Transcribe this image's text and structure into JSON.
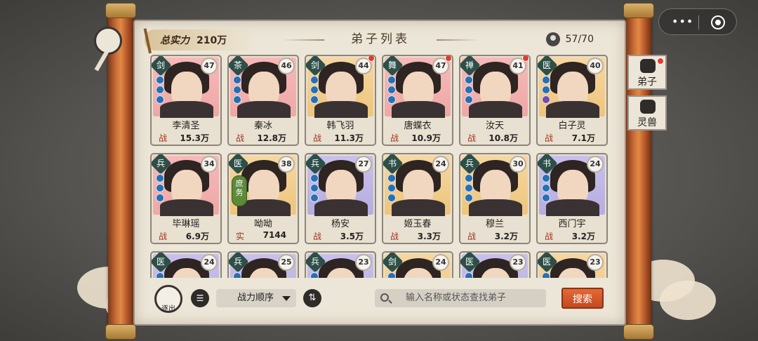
{
  "header": {
    "power_label": "总实力",
    "power_value": "210万",
    "title": "弟子列表",
    "count": "57/70"
  },
  "cards": [
    {
      "tag": "剑",
      "level": "47",
      "name": "李清圣",
      "stat_label": "战",
      "stat_value": "15.3万",
      "bg": "pink",
      "dot": false
    },
    {
      "tag": "茶",
      "level": "46",
      "name": "秦冰",
      "stat_label": "战",
      "stat_value": "12.8万",
      "bg": "pink",
      "dot": false
    },
    {
      "tag": "剑",
      "level": "44",
      "name": "韩飞羽",
      "stat_label": "战",
      "stat_value": "11.3万",
      "bg": "gold",
      "dot": true
    },
    {
      "tag": "舞",
      "level": "47",
      "name": "唐蝶衣",
      "stat_label": "战",
      "stat_value": "10.9万",
      "bg": "pink",
      "dot": true
    },
    {
      "tag": "禅",
      "level": "41",
      "name": "汝天",
      "stat_label": "战",
      "stat_value": "10.8万",
      "bg": "pink",
      "dot": true
    },
    {
      "tag": "医",
      "level": "40",
      "name": "白子灵",
      "stat_label": "战",
      "stat_value": "7.1万",
      "bg": "gold",
      "dot": false
    },
    {
      "tag": "兵",
      "level": "34",
      "name": "毕琳瑶",
      "stat_label": "战",
      "stat_value": "6.9万",
      "bg": "pink",
      "dot": false
    },
    {
      "tag": "医",
      "level": "38",
      "name": "呦呦",
      "stat_label": "实",
      "stat_value": "7144",
      "bg": "gold",
      "dot": false,
      "dept": "庶务"
    },
    {
      "tag": "兵",
      "level": "27",
      "name": "杨安",
      "stat_label": "战",
      "stat_value": "3.5万",
      "bg": "purple",
      "dot": false
    },
    {
      "tag": "书",
      "level": "24",
      "name": "姬玉春",
      "stat_label": "战",
      "stat_value": "3.3万",
      "bg": "gold",
      "dot": false
    },
    {
      "tag": "兵",
      "level": "30",
      "name": "穆兰",
      "stat_label": "战",
      "stat_value": "3.2万",
      "bg": "gold",
      "dot": false
    },
    {
      "tag": "书",
      "level": "24",
      "name": "西门宇",
      "stat_label": "战",
      "stat_value": "3.2万",
      "bg": "purple",
      "dot": false
    },
    {
      "tag": "医",
      "level": "24",
      "name": "",
      "stat_label": "",
      "stat_value": "",
      "bg": "purple",
      "dot": false
    },
    {
      "tag": "兵",
      "level": "25",
      "name": "",
      "stat_label": "",
      "stat_value": "",
      "bg": "purple",
      "dot": false
    },
    {
      "tag": "兵",
      "level": "23",
      "name": "",
      "stat_label": "",
      "stat_value": "",
      "bg": "purple",
      "dot": false
    },
    {
      "tag": "剑",
      "level": "24",
      "name": "",
      "stat_label": "",
      "stat_value": "",
      "bg": "gold",
      "dot": false
    },
    {
      "tag": "医",
      "level": "23",
      "name": "",
      "stat_label": "",
      "stat_value": "",
      "bg": "purple",
      "dot": false
    },
    {
      "tag": "医",
      "level": "23",
      "name": "",
      "stat_label": "",
      "stat_value": "",
      "bg": "gold",
      "dot": false
    }
  ],
  "toolbar": {
    "exit_label": "逐出",
    "list_icon": "list-icon",
    "sort_label": "战力顺序",
    "swap_icon": "swap-icon",
    "search_placeholder": "输入名称或状态查找弟子",
    "search_button": "搜索"
  },
  "side_tabs": [
    {
      "label": "弟子",
      "icon": "disciple-icon",
      "dot": true
    },
    {
      "label": "灵兽",
      "icon": "beast-icon",
      "dot": false
    }
  ]
}
